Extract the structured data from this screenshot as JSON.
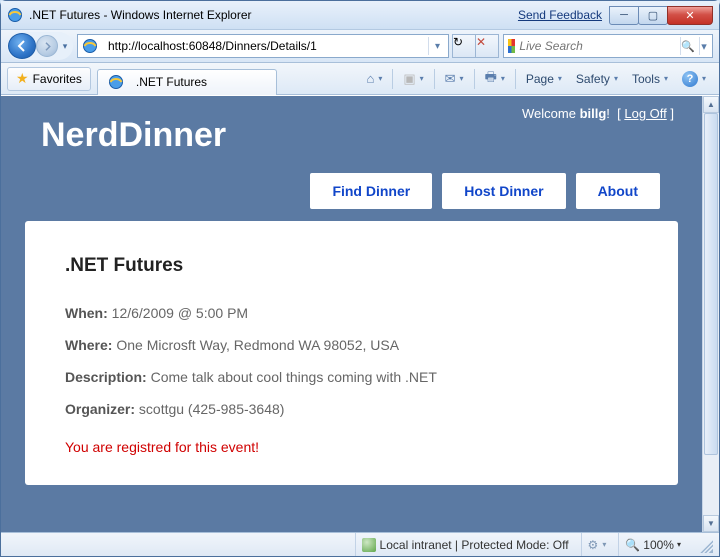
{
  "window": {
    "title": ".NET Futures - Windows Internet Explorer",
    "feedback": "Send Feedback"
  },
  "nav": {
    "url": "http://localhost:60848/Dinners/Details/1",
    "search_placeholder": "Live Search"
  },
  "cmd": {
    "favorites": "Favorites",
    "tab_title": ".NET Futures",
    "page": "Page",
    "safety": "Safety",
    "tools": "Tools"
  },
  "site": {
    "logo": "NerdDinner",
    "welcome_prefix": "Welcome ",
    "username": "billg",
    "excl": "!",
    "logoff": "Log Off",
    "nav": {
      "find": "Find Dinner",
      "host": "Host Dinner",
      "about": "About"
    }
  },
  "dinner": {
    "title": ".NET Futures",
    "when_label": "When:",
    "when": "12/6/2009 @ 5:00 PM",
    "where_label": "Where:",
    "where": "One Microsft Way, Redmond WA 98052, USA",
    "desc_label": "Description:",
    "desc": "Come talk about cool things coming with .NET",
    "org_label": "Organizer:",
    "org": "scottgu (425-985-3648)",
    "registered": "You are registred for this event!"
  },
  "status": {
    "zone": "Local intranet | Protected Mode: Off",
    "zoom": "100%"
  }
}
